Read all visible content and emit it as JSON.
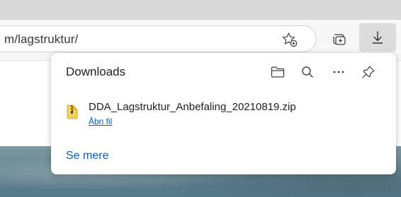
{
  "address_bar": {
    "url_text": "m/lagstruktur/"
  },
  "toolbar": {
    "favorites_icon": "star-plus-icon",
    "collections_icon": "collections-icon",
    "downloads_icon": "download-arrow-icon"
  },
  "downloads_panel": {
    "title": "Downloads",
    "header_icons": [
      "folder-icon",
      "search-icon",
      "more-icon",
      "pin-icon"
    ],
    "items": [
      {
        "file_name": "DDA_Lagstruktur_Anbefaling_20210819.zip",
        "action_label": "Åbn fil",
        "file_icon": "zip-file-icon"
      }
    ],
    "see_more_label": "Se mere"
  },
  "colors": {
    "link": "#0b5cc0",
    "active_button": "#dcdcdc",
    "panel_background": "#ffffff"
  }
}
